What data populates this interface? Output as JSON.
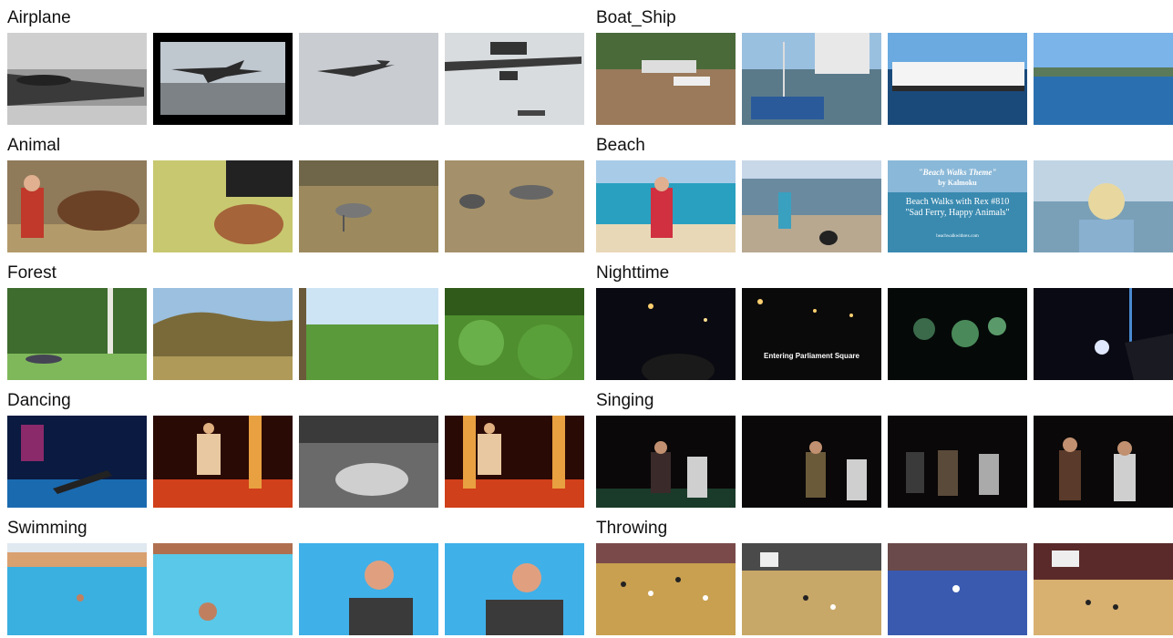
{
  "categories": [
    {
      "label": "Airplane"
    },
    {
      "label": "Animal"
    },
    {
      "label": "Forest"
    },
    {
      "label": "Dancing"
    },
    {
      "label": "Swimming"
    },
    {
      "label": "Boat_Ship"
    },
    {
      "label": "Beach"
    },
    {
      "label": "Nighttime"
    },
    {
      "label": "Singing"
    },
    {
      "label": "Throwing"
    }
  ],
  "frames": {
    "nighttime_caption": "Entering Parliament Square",
    "beach_title_line1": "\"Beach Walks Theme\"",
    "beach_title_line2": "by Kalmoku",
    "beach_title_line3": "Beach Walks with Rex #810",
    "beach_title_line4": "\"Sad Ferry, Happy Animals\"",
    "beach_title_line5": "beachwalkwithrex.com"
  },
  "colors": {
    "background": "#ffffff",
    "label_text": "#111111"
  }
}
